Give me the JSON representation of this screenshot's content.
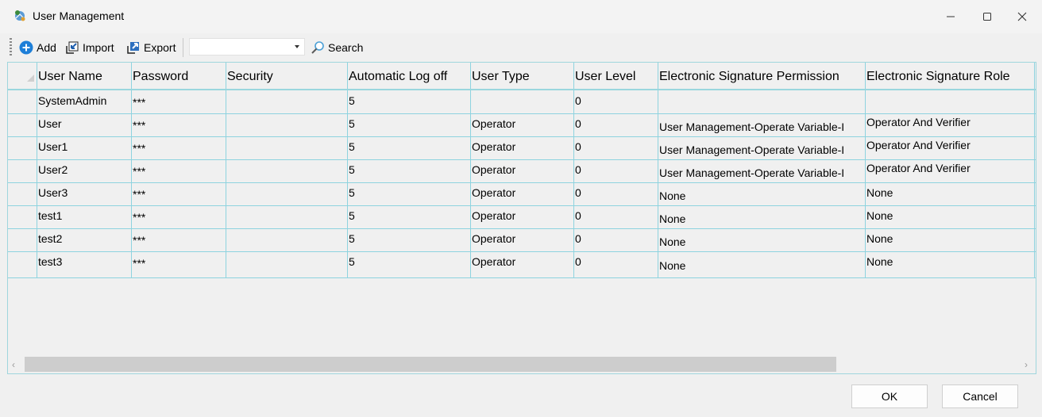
{
  "window": {
    "title": "User Management",
    "icon": "app-globe-icon",
    "controls": [
      "minimize-icon",
      "maximize-icon",
      "close-icon"
    ]
  },
  "toolbar": {
    "add_label": "Add",
    "import_label": "Import",
    "export_label": "Export",
    "search_combo_value": "",
    "search_label": "Search"
  },
  "table": {
    "columns": [
      "User Name",
      "Password",
      "Security",
      "Automatic Log off",
      "User Type",
      "User Level",
      "Electronic Signature Permission",
      "Electronic Signature Role"
    ],
    "rows": [
      [
        "SystemAdmin",
        "***",
        "",
        "5",
        "",
        "0",
        "",
        ""
      ],
      [
        "User",
        "***",
        "",
        "5",
        "Operator",
        "0",
        "User Management-Operate Variable-I",
        "Operator And Verifier"
      ],
      [
        "User1",
        "***",
        "",
        "5",
        "Operator",
        "0",
        "User Management-Operate Variable-I",
        "Operator And Verifier"
      ],
      [
        "User2",
        "***",
        "",
        "5",
        "Operator",
        "0",
        "User Management-Operate Variable-I",
        "Operator And Verifier"
      ],
      [
        "User3",
        "***",
        "",
        "5",
        "Operator",
        "0",
        "None",
        "None"
      ],
      [
        "test1",
        "***",
        "",
        "5",
        "Operator",
        "0",
        "None",
        "None"
      ],
      [
        "test2",
        "***",
        "",
        "5",
        "Operator",
        "0",
        "None",
        "None"
      ],
      [
        "test3",
        "***",
        "",
        "5",
        "Operator",
        "0",
        "None",
        "None"
      ]
    ]
  },
  "footer": {
    "ok_label": "OK",
    "cancel_label": "Cancel"
  },
  "colors": {
    "grid_line": "#8ed3df",
    "window_bg": "#f0f0f0",
    "add_icon": "#1e7fd8",
    "export_icon": "#2d6fbf"
  }
}
